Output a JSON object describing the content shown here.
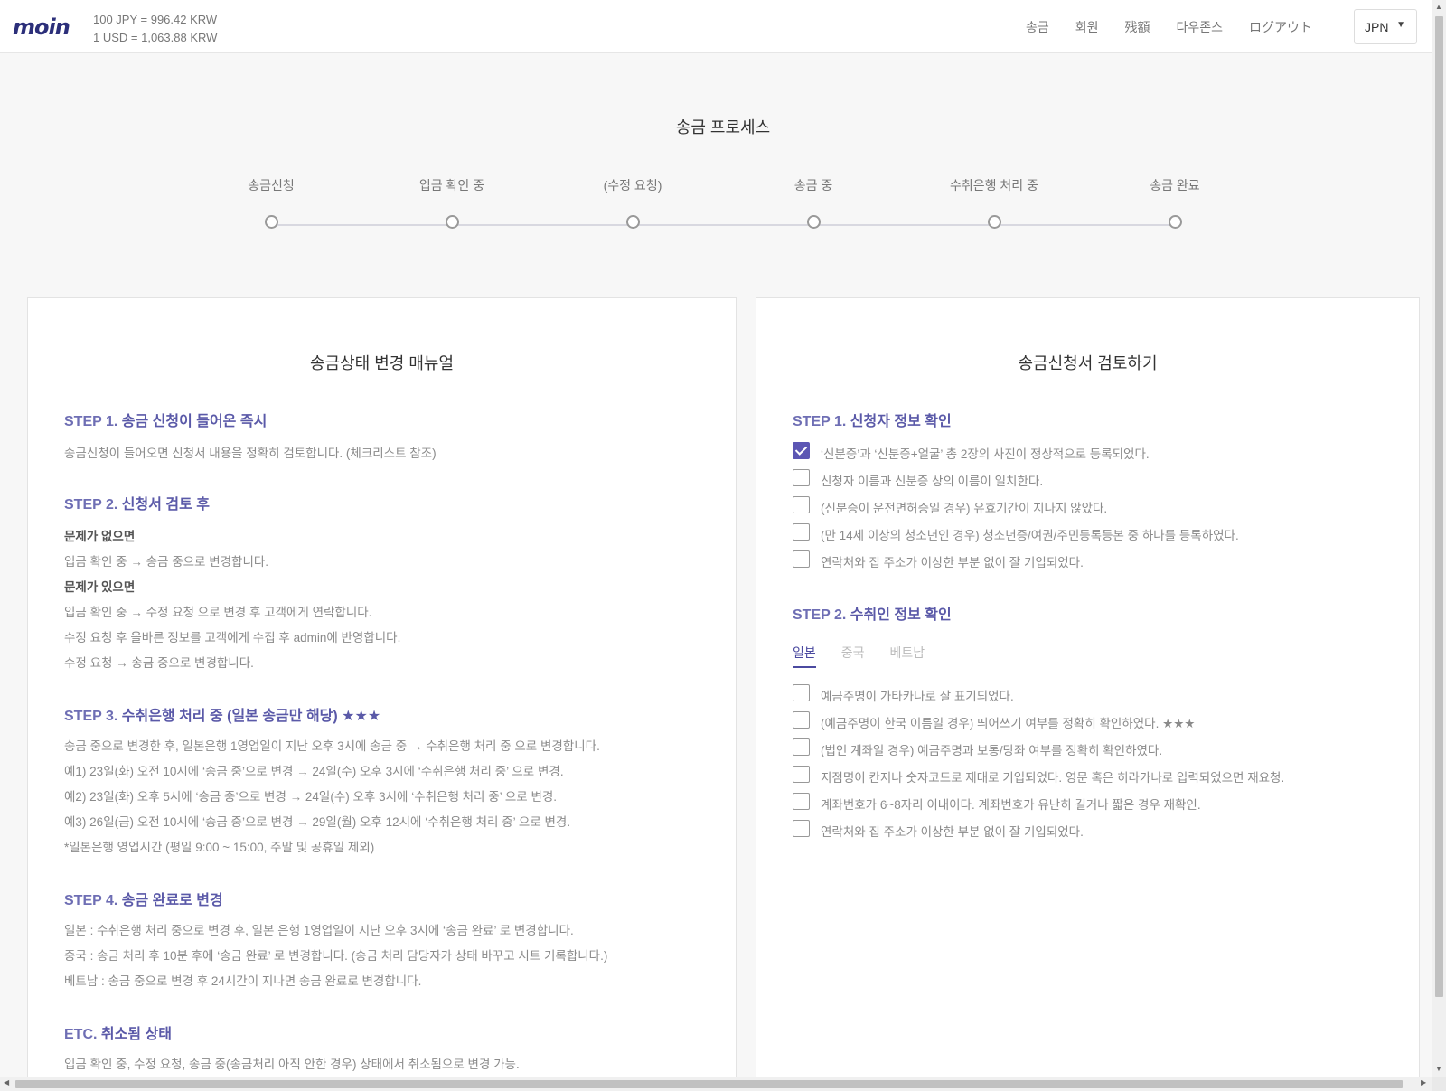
{
  "header": {
    "logo": "moin",
    "rate_jpy": "100 JPY = 996.42 KRW",
    "rate_usd": "1 USD = 1,063.88 KRW",
    "nav": [
      "송금",
      "회원",
      "残額",
      "다우존스",
      "ログアウト"
    ],
    "language": "JPN"
  },
  "process": {
    "title": "송금 프로세스",
    "steps": [
      "송금신청",
      "입금 확인 중",
      "(수정 요청)",
      "송금 중",
      "수취은행 처리 중",
      "송금 완료"
    ]
  },
  "manual": {
    "title": "송금상태 변경 매뉴얼",
    "step1": {
      "prefix": "STEP 1.",
      "title": "송금 신청이 들어온 즉시",
      "body": "송금신청이 들어오면 신청서 내용을 정확히 검토합니다. (체크리스트 참조)"
    },
    "step2": {
      "prefix": "STEP 2.",
      "title": "신청서 검토 후",
      "ok_label": "문제가 없으면",
      "ok_1": "입금 확인 중 → 송금 중으로 변경합니다.",
      "ng_label": "문제가 있으면",
      "ng_1": "입금 확인 중 → 수정 요청 으로 변경 후 고객에게 연락합니다.",
      "ng_2": "수정 요청 후 올바른 정보를 고객에게 수집 후 admin에 반영합니다.",
      "ng_3": "수정 요청 → 송금 중으로 변경합니다."
    },
    "step3": {
      "prefix": "STEP 3.",
      "title": "수취은행 처리 중 (일본 송금만 해당) ★★★",
      "line1": "송금 중으로 변경한 후, 일본은행 1영업일이 지난 오후 3시에 송금 중 → 수취은행 처리 중 으로 변경합니다.",
      "line2": "예1) 23일(화) 오전 10시에 ‘송금 중’으로 변경 → 24일(수) 오후 3시에 ‘수취은행 처리 중’ 으로 변경.",
      "line3": "예2) 23일(화) 오후 5시에 ‘송금 중’으로 변경 → 24일(수) 오후 3시에 ‘수취은행 처리 중’ 으로 변경.",
      "line4": "예3) 26일(금) 오전 10시에 ‘송금 중’으로 변경 → 29일(월) 오후 12시에 ‘수취은행 처리 중’ 으로 변경.",
      "line5": "*일본은행 영업시간 (평일 9:00 ~ 15:00, 주말 및 공휴일 제외)"
    },
    "step4": {
      "prefix": "STEP 4.",
      "title": "송금 완료로 변경",
      "line1": "일본 : 수취은행 처리 중으로 변경 후, 일본 은행 1영업일이 지난 오후 3시에 ‘송금 완료’ 로 변경합니다.",
      "line2": "중국 : 송금 처리 후 10분 후에 ‘송금 완료’ 로 변경합니다. (송금 처리 담당자가 상태 바꾸고 시트 기록합니다.)",
      "line3": "베트남 : 송금 중으로 변경 후 24시간이 지나면 송금 완료로 변경합니다."
    },
    "etc": {
      "prefix": "ETC.",
      "title": "취소됨 상태",
      "line1": "입금 확인 중, 수정 요청, 송금 중(송금처리 아직 안한 경우) 상태에서 취소됨으로 변경 가능."
    }
  },
  "review": {
    "title": "송금신청서 검토하기",
    "step1": {
      "prefix": "STEP 1.",
      "title": "신청자 정보 확인",
      "items": [
        {
          "label": "‘신분증’과 ‘신분증+얼굴’ 총 2장의 사진이 정상적으로 등록되었다.",
          "checked": true
        },
        {
          "label": "신청자 이름과 신분증 상의 이름이 일치한다.",
          "checked": false
        },
        {
          "label": "(신분증이 운전면허증일 경우) 유효기간이 지나지 않았다.",
          "checked": false
        },
        {
          "label": "(만 14세 이상의 청소년인 경우) 청소년증/여권/주민등록등본 중 하나를 등록하였다.",
          "checked": false
        },
        {
          "label": "연락처와 집 주소가 이상한 부분 없이 잘 기입되었다.",
          "checked": false
        }
      ]
    },
    "step2": {
      "prefix": "STEP 2.",
      "title": "수취인 정보 확인",
      "tabs": [
        "일본",
        "중국",
        "베트남"
      ],
      "active_tab": "일본",
      "items": [
        {
          "label": "예금주명이 가타카나로 잘 표기되었다.",
          "checked": false
        },
        {
          "label": "(예금주명이 한국 이름일 경우) 띄어쓰기 여부를 정확히 확인하였다. ★★★",
          "checked": false
        },
        {
          "label": "(법인 계좌일 경우) 예금주명과 보통/당좌 여부를 정확히 확인하였다.",
          "checked": false
        },
        {
          "label": "지점명이 칸지나 숫자코드로 제대로 기입되었다. 영문 혹은 히라가나로 입력되었으면 재요청.",
          "checked": false
        },
        {
          "label": "계좌번호가 6~8자리 이내이다. 계좌번호가 유난히 길거나 짧은 경우 재확인.",
          "checked": false
        },
        {
          "label": "연락처와 집 주소가 이상한 부분 없이 잘 기입되었다.",
          "checked": false
        }
      ]
    }
  },
  "colors": {
    "accent": "#5c56b4",
    "heading": "#5a59a8",
    "muted": "#8a8a8a"
  }
}
